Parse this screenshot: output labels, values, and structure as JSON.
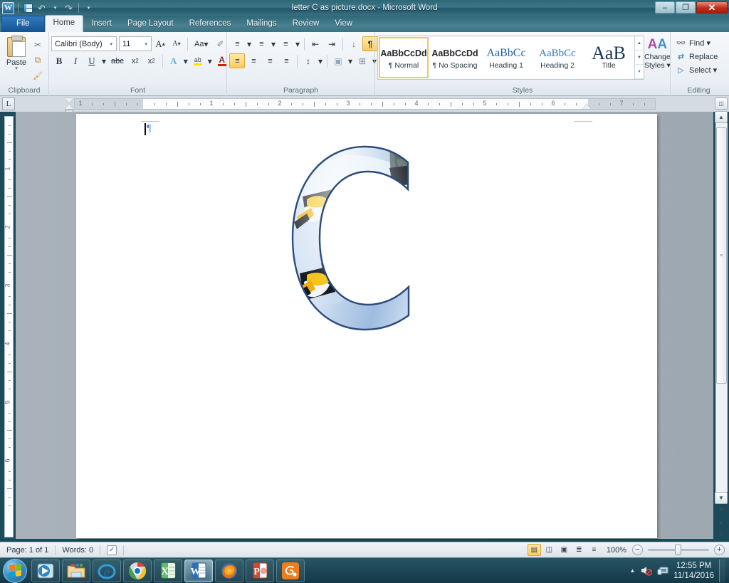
{
  "window": {
    "title": "letter C as picture.docx  -  Microsoft Word",
    "minimize_label": "–",
    "restore_label": "❐",
    "close_label": "✕"
  },
  "qat": {
    "app_icon": "word-icon",
    "save_label": "save-icon",
    "undo_label": "↶",
    "undo_caret": "▾",
    "redo_label": "↷",
    "customize_caret": "▾"
  },
  "tabs": [
    {
      "label": "File",
      "type": "file"
    },
    {
      "label": "Home",
      "type": "active"
    },
    {
      "label": "Insert",
      "type": "normal"
    },
    {
      "label": "Page Layout",
      "type": "normal"
    },
    {
      "label": "References",
      "type": "normal"
    },
    {
      "label": "Mailings",
      "type": "normal"
    },
    {
      "label": "Review",
      "type": "normal"
    },
    {
      "label": "View",
      "type": "normal"
    }
  ],
  "ribbon": {
    "clipboard": {
      "group_label": "Clipboard",
      "paste_label": "Paste",
      "paste_caret": "▾",
      "cut_label": "✂",
      "copy_label": "⧉",
      "format_painter_label": "🖌"
    },
    "font": {
      "group_label": "Font",
      "font_name": "Calibri (Body)",
      "font_size": "11",
      "grow_font": "A",
      "shrink_font": "A",
      "change_case": "Aa",
      "clear_formatting": "✐",
      "bold": "B",
      "italic": "I",
      "underline": "U",
      "strikethrough": "abc",
      "subscript": "x",
      "subscript_sub": "2",
      "superscript": "x",
      "superscript_sup": "2",
      "text_effects": "A",
      "highlight": "ab",
      "font_color": "A",
      "caret": "▾"
    },
    "paragraph": {
      "group_label": "Paragraph",
      "bullets": "≡",
      "numbering": "≡",
      "multilevel": "≡",
      "decrease_indent": "⇤",
      "increase_indent": "⇥",
      "sort": "↓",
      "show_marks": "¶",
      "align_left": "≡",
      "align_center": "≡",
      "align_right": "≡",
      "justify": "≡",
      "line_spacing": "↕",
      "shading": "▣",
      "borders": "⊞",
      "caret": "▾"
    },
    "styles": {
      "group_label": "Styles",
      "items": [
        {
          "preview": "AaBbCcDd",
          "name": "¶ Normal",
          "selected": true
        },
        {
          "preview": "AaBbCcDd",
          "name": "¶ No Spacing",
          "selected": false
        },
        {
          "preview": "AaBbCc",
          "name": "Heading 1",
          "selected": false
        },
        {
          "preview": "AaBbCc",
          "name": "Heading 2",
          "selected": false
        },
        {
          "preview": "AaB",
          "name": "Title",
          "selected": false
        }
      ],
      "scroll_up": "▲",
      "scroll_down": "▼",
      "more": "▾",
      "change_styles_line1": "Change",
      "change_styles_line2": "Styles ▾"
    },
    "editing": {
      "group_label": "Editing",
      "find_label": "Find ▾",
      "replace_label": "Replace",
      "select_label": "Select ▾",
      "find_icon": "binoculars-icon",
      "replace_icon": "replace-icon",
      "select_icon": "pointer-icon"
    },
    "dialog_launcher": "↘"
  },
  "ruler": {
    "tab_selector": "L",
    "h_numbers": [
      "1",
      "1",
      "2",
      "3",
      "4",
      "5",
      "6",
      "7"
    ],
    "v_numbers": [
      "1",
      "2",
      "3",
      "4",
      "5",
      "6"
    ]
  },
  "document": {
    "paragraph_mark": "¶",
    "image_alt": "Letter C filled with a penguin photograph",
    "image_name": "letter-c-picture"
  },
  "status": {
    "page_label": "Page: 1 of 1",
    "words_label": "Words: 0",
    "proofing_icon": "spellcheck-icon",
    "views": [
      {
        "name": "print-layout",
        "glyph": "▤",
        "active": true
      },
      {
        "name": "full-screen-reading",
        "glyph": "◫",
        "active": false
      },
      {
        "name": "web-layout",
        "glyph": "▣",
        "active": false
      },
      {
        "name": "outline",
        "glyph": "≣",
        "active": false
      },
      {
        "name": "draft",
        "glyph": "≡",
        "active": false
      }
    ],
    "zoom_level": "100%",
    "zoom_out": "−",
    "zoom_in": "+"
  },
  "taskbar": {
    "start_label": "start-orb",
    "apps": [
      {
        "name": "windows-media-player",
        "state": "pinned"
      },
      {
        "name": "windows-explorer",
        "state": "pinned"
      },
      {
        "name": "internet-explorer",
        "state": "pinned"
      },
      {
        "name": "google-chrome",
        "state": "pinned"
      },
      {
        "name": "microsoft-excel",
        "state": "pinned"
      },
      {
        "name": "microsoft-word",
        "state": "active"
      },
      {
        "name": "mozilla-firefox",
        "state": "pinned"
      },
      {
        "name": "microsoft-powerpoint",
        "state": "pinned"
      },
      {
        "name": "camtasia",
        "state": "pinned"
      }
    ],
    "tray": {
      "show_hidden": "▲",
      "volume_icon": "volume-muted-icon",
      "network_icon": "network-icon",
      "time": "12:55 PM",
      "date": "11/14/2016"
    }
  },
  "colors": {
    "accent": "#2e6877",
    "ribbon_bg": "#eaeff4",
    "highlight": "#fdcc5a",
    "file_tab": "#1d5d9e",
    "letter_c_stroke": "#2b4b7c"
  }
}
